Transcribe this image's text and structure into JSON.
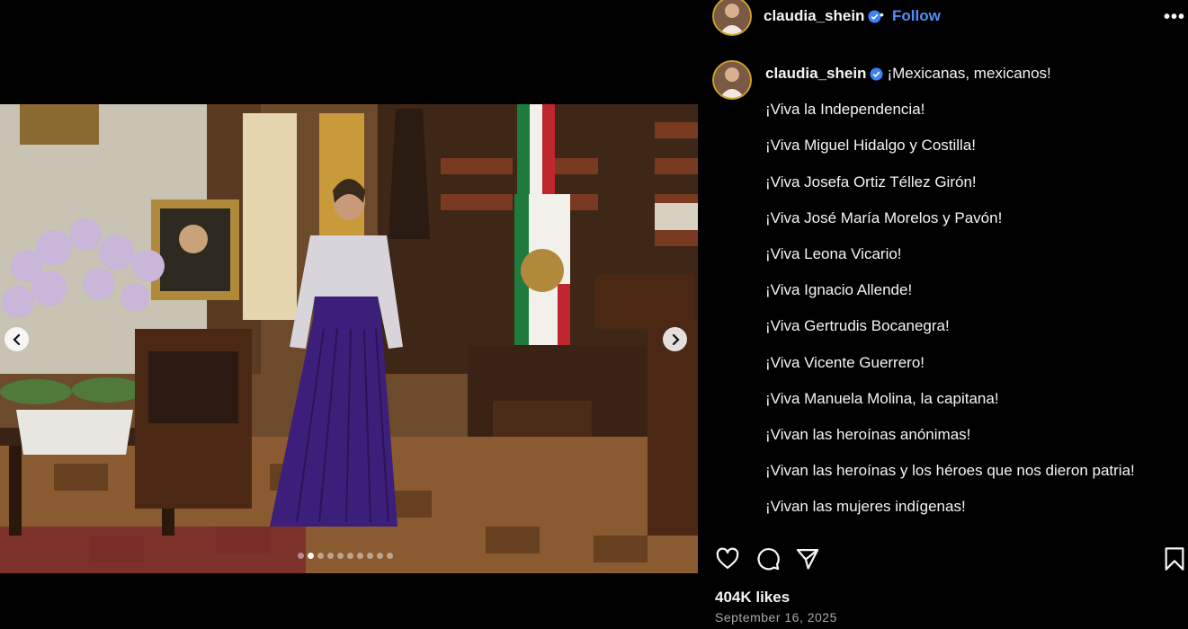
{
  "post": {
    "username": "claudia_shein",
    "follow_label": "Follow",
    "separator": "•",
    "more_label": "•••"
  },
  "caption": {
    "first_line": "¡Mexicanas, mexicanos!",
    "lines": [
      "¡Viva la Independencia!",
      "¡Viva Miguel Hidalgo y Costilla!",
      "¡Viva Josefa Ortiz Téllez Girón!",
      "¡Viva José María Morelos y Pavón!",
      "¡Viva Leona Vicario!",
      "¡Viva Ignacio Allende!",
      "¡Viva Gertrudis Bocanegra!",
      "¡Viva Vicente Guerrero!",
      "¡Viva Manuela Molina, la capitana!",
      "¡Vivan las heroínas anónimas!",
      "¡Vivan las heroínas y los héroes que nos dieron patria!",
      "¡Vivan las mujeres indígenas!"
    ]
  },
  "stats": {
    "likes": "404K likes",
    "date": "September 16, 2025"
  },
  "carousel": {
    "total": 10,
    "active_index": 1
  },
  "colors": {
    "follow": "#4f8ff7",
    "verified": "#3b82f6",
    "dress": "#3c1f7a"
  }
}
